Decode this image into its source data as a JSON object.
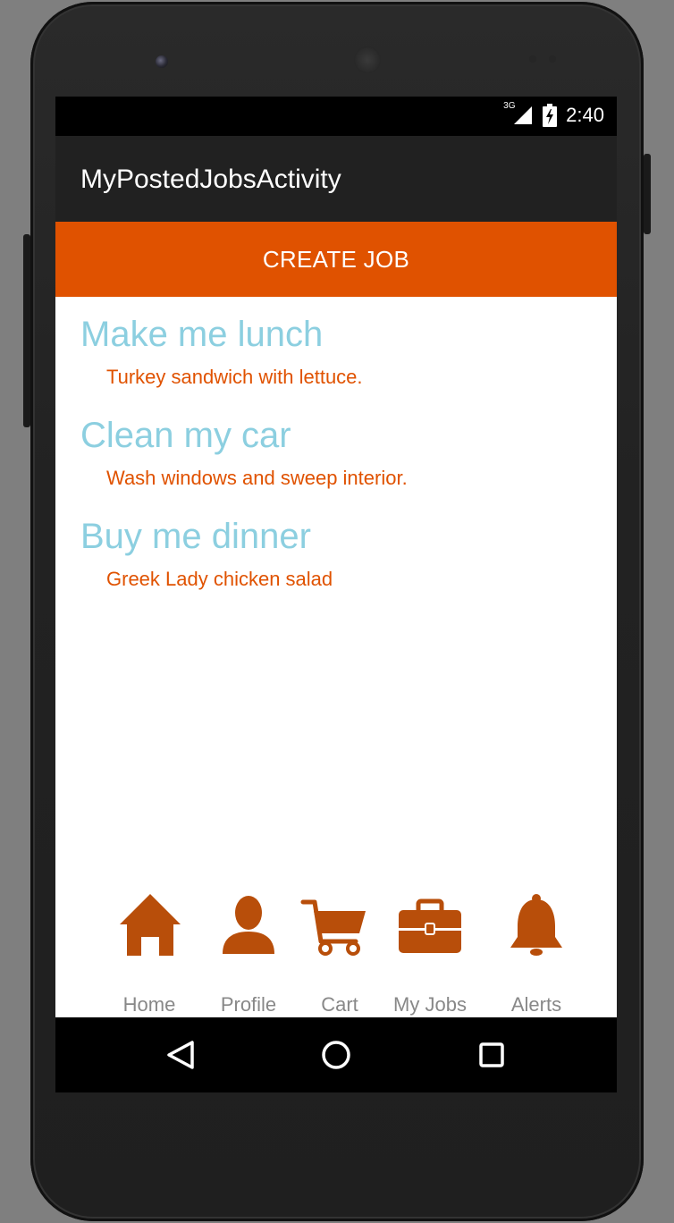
{
  "status_bar": {
    "network": "3G",
    "time": "2:40"
  },
  "app_bar": {
    "title": "MyPostedJobsActivity"
  },
  "create_button": {
    "label": "CREATE JOB"
  },
  "jobs": [
    {
      "title": "Make me lunch",
      "description": "Turkey sandwich with lettuce."
    },
    {
      "title": "Clean my car",
      "description": "Wash windows and sweep interior."
    },
    {
      "title": "Buy me dinner",
      "description": "Greek Lady chicken salad"
    }
  ],
  "bottom_nav": {
    "items": [
      {
        "label": "Home",
        "icon": "home-icon"
      },
      {
        "label": "Profile",
        "icon": "profile-icon"
      },
      {
        "label": "Cart",
        "icon": "cart-icon"
      },
      {
        "label": "My Jobs",
        "icon": "briefcase-icon"
      },
      {
        "label": "Alerts",
        "icon": "bell-icon"
      }
    ]
  },
  "system_nav": {
    "back": "back-icon",
    "home": "home-circle-icon",
    "recents": "recents-icon"
  },
  "colors": {
    "accent": "#e05200",
    "icon": "#b84e0a",
    "job_title": "#8ccfe0",
    "app_bar": "#212121",
    "nav_label": "#888888"
  }
}
